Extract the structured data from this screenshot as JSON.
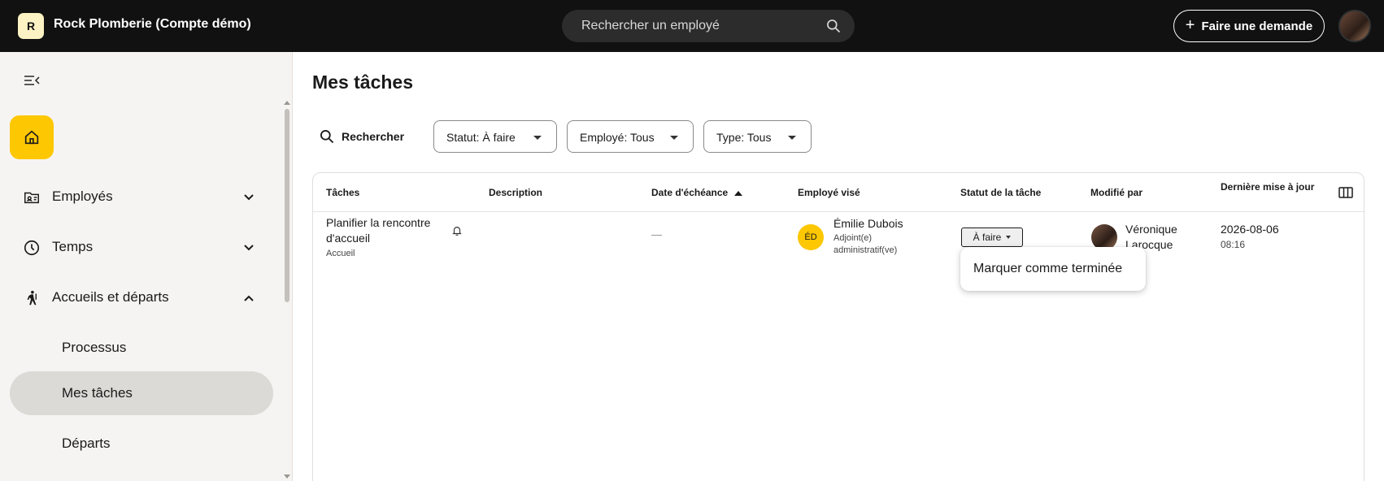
{
  "header": {
    "brand_initial": "R",
    "company": "Rock Plomberie (Compte démo)",
    "search_placeholder": "Rechercher un employé",
    "request_label": "Faire une demande"
  },
  "sidebar": {
    "items": [
      {
        "label": "Employés",
        "icon": "id-card-icon",
        "expanded": false
      },
      {
        "label": "Temps",
        "icon": "clock-icon",
        "expanded": false
      },
      {
        "label": "Accueils et départs",
        "icon": "walking-person-icon",
        "expanded": true
      }
    ],
    "subitems": [
      {
        "label": "Processus",
        "active": false
      },
      {
        "label": "Mes tâches",
        "active": true
      },
      {
        "label": "Départs",
        "active": false
      }
    ]
  },
  "main": {
    "title": "Mes tâches",
    "search_label": "Rechercher",
    "filters": [
      "Statut: À faire",
      "Employé: Tous",
      "Type: Tous"
    ]
  },
  "table": {
    "columns": [
      "Tâches",
      "Description",
      "Date d'échéance",
      "Employé visé",
      "Statut de la tâche",
      "Modifié par",
      "Dernière mise à jour"
    ],
    "sorted_column": "Date d'échéance",
    "rows": [
      {
        "task": "Planifier la rencontre d'accueil",
        "task_type": "Accueil",
        "description": "",
        "due_date": "—",
        "employee_initials": "ÉD",
        "employee_name": "Émilie Dubois",
        "employee_role": "Adjoint(e) administratif(ve)",
        "status": "À faire",
        "modified_by": "Véronique Larocque",
        "updated_date": "2026-08-06",
        "updated_time": "08:16"
      }
    ]
  },
  "status_menu": {
    "items": [
      "Marquer comme terminée"
    ]
  },
  "colors": {
    "topbar": "#111111",
    "accent": "#fdc701",
    "sidebar_bg": "#f6f4f2",
    "active_item": "#dcdad7"
  }
}
